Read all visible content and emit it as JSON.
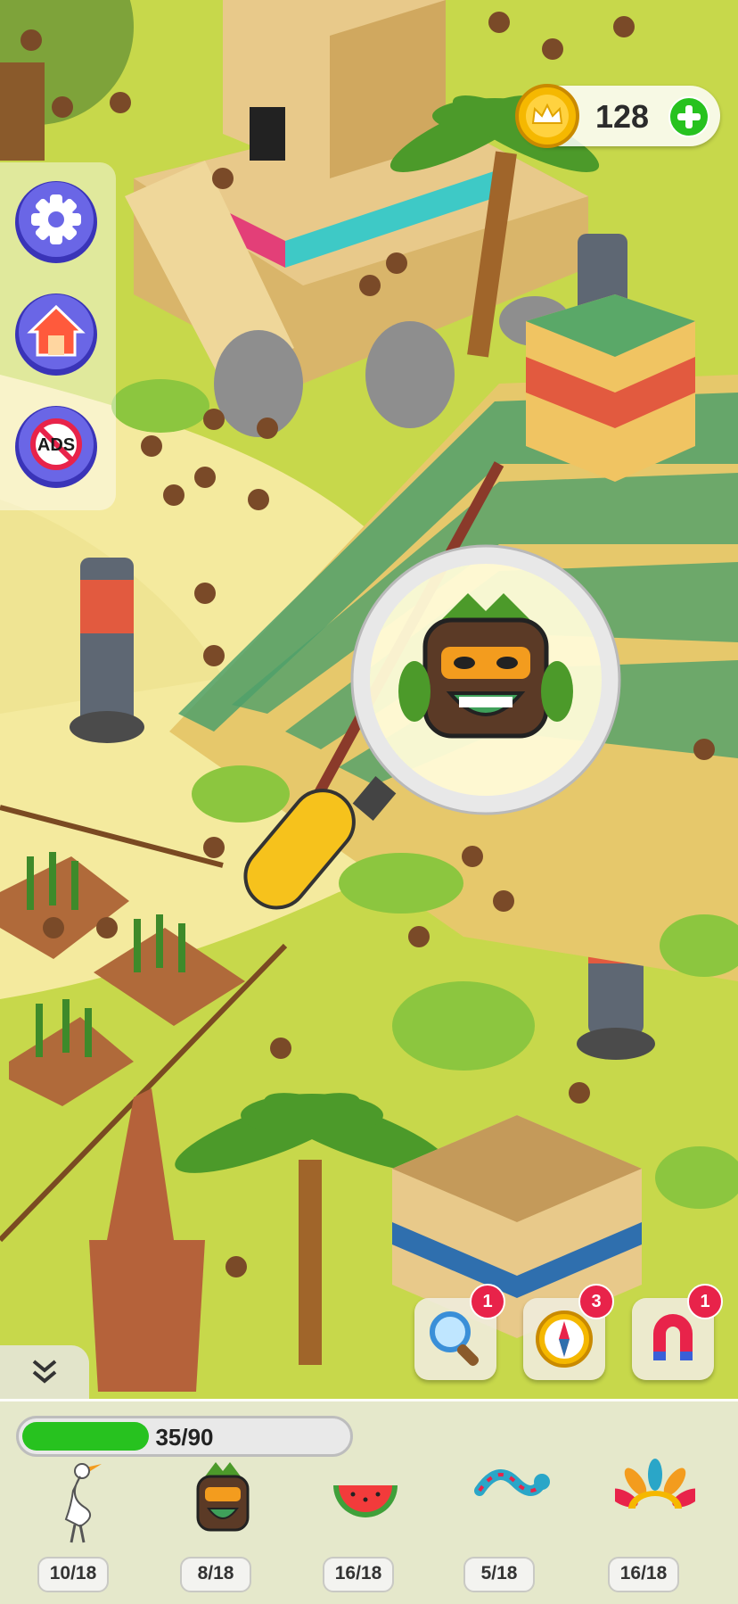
{
  "hud": {
    "coins": "128"
  },
  "side_menu": {
    "ads_label": "ADS"
  },
  "powerups": [
    {
      "name": "magnifier",
      "count": "1"
    },
    {
      "name": "compass",
      "count": "3"
    },
    {
      "name": "magnet",
      "count": "1"
    }
  ],
  "search": {
    "current_target": "tiki-mask"
  },
  "progress": {
    "label": "35/90",
    "fraction": 0.389
  },
  "targets": [
    {
      "icon": "heron-icon",
      "count": "10/18"
    },
    {
      "icon": "tiki-mask-icon",
      "count": "8/18"
    },
    {
      "icon": "watermelon-icon",
      "count": "16/18"
    },
    {
      "icon": "snake-icon",
      "count": "5/18"
    },
    {
      "icon": "headdress-icon",
      "count": "16/18"
    }
  ],
  "colors": {
    "accent_green": "#27c21f",
    "badge_red": "#e8234a",
    "button_purple": "#5b5bd6",
    "coin_gold": "#f5b800"
  }
}
